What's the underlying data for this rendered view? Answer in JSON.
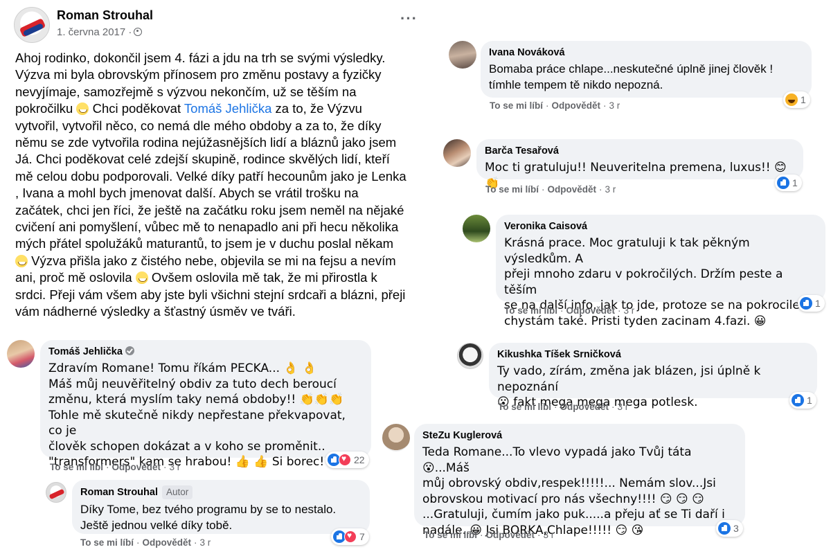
{
  "post": {
    "author": "Roman Strouhal",
    "date": "1. června 2017 ·",
    "more_label": "···",
    "text_parts": {
      "p1": "Ahoj rodinko, dokončil jsem 4. fázi a jdu na trh se svými výsledky.\nVýzva mi byla obrovským přínosem pro změnu postavy a fyzičky\nnevyjímaje, samozřejmě  s výzvou nekončím, už se těším na\npokročilku ",
      "p2": " Chci poděkovat ",
      "mention": "Tomáš Jehlička",
      "p3": " za to, že Výzvu\nvytvořil, vytvořil něco, co nemá dle mého obdoby a za to, že díky\nněmu se zde vytvořila rodina nejúžasnějších lidí a bláznů jako jsem\nJá. Chci poděkovat celé zdejší skupině, rodince skvělých lidí, kteří\nmě celou dobu podporovali. Velké díky patří hecounům jako je Lenka\n, Ivana a mohl bych jmenovat další. Abych se vrátil trošku na\nzačátek, chci jen říci, že ještě na začátku roku jsem neměl na nějaké\ncvičení ani pomyšlení, vůbec mě to nenapadlo ani při hecu několika\nmých přátel spolužáků maturantů, to jsem je v duchu poslal někam\n",
      "p4": " Výzva přišla jako z čistého nebe, objevila se mi na fejsu a nevím\nani, proč mě oslovila ",
      "p5": " Ovšem oslovila mě tak, že mi přirostla k\nsrdci. Přeji vám všem aby jste byli všichni stejní srdcaři a blázni, přeji\nvám nádherné výsledky a šťastný úsměv ve tváři."
    }
  },
  "actions": {
    "like": "To se mi líbí",
    "reply": "Odpovědět",
    "sep": "·"
  },
  "comments": {
    "tomas": {
      "author": "Tomáš Jehlička",
      "text": "Zdravím Romane! Tomu říkám PECKA... 👌 👌\nMáš můj neuvěřitelný obdiv za tuto dech beroucí\nzměnu, která myslím taky nemá obdoby!! 👏👏👏\nTohle mě skutečně nikdy nepřestane překvapovat, co je\nčlověk schopen dokázat a v koho se proměnit..\n\"transformers\" kam se hrabou! 👍 👍 Si borec!",
      "age": "3 r",
      "reactions": "22"
    },
    "roman_reply": {
      "author": "Roman Strouhal",
      "tag": "Autor",
      "text": "Díky Tome, bez tvého programu by se to nestalo.\nJeště jednou velké díky tobě.",
      "age": "3 r",
      "reactions": "7"
    },
    "ivana": {
      "author": "Ivana Nováková",
      "text": "Bomaba práce chlape...neskutečné úplně jinej člověk !\ntímhle tempem tě nikdo nepozná.",
      "age": "3 r",
      "reactions": "1"
    },
    "barca": {
      "author": "Barča Tesařová",
      "text": "Moc ti gratuluju!! Neuveritelna premena, luxus!! 😊👏",
      "age": "3 r",
      "reactions": "1"
    },
    "veronika": {
      "author": "Veronika Caisová",
      "text": "Krásná prace. Moc gratuluji k tak pěkným výsledkům. A\npřeji mnoho zdaru v pokročilých. Držím peste a těším\nse na další info, jak to jde, protoze se na pokrocile\nchystám také. Pristi tyden zacinam 4.fazi. 😀",
      "age": "3 r",
      "reactions": "1"
    },
    "kikushka": {
      "author": "Kikushka Tíšek Srnička",
      "author_full": "Kikushka Tíšek Srničková",
      "text": "Ty vado, zírám, změna jak blázen, jsi úplně k nepoznání\n😮 fakt mega mega mega potlesk.",
      "age": "3 r",
      "reactions": "1"
    },
    "stezu": {
      "author": "SteZu Kuglerová",
      "text": "Teda Romane...To vlevo vypadá jako Tvůj táta 😮...Máš\nmůj obrovský obdiv,respek!!!!!... Nemám slov...Jsi\nobrovskou motivací pro nás všechny!!!! 😏  😏  😏\n...Gratuluji, čumím jako puk.....a přeju ať se Ti daří i\nnadále..😀 Jsi BORKA,Chlape!!!!! 😏  😘",
      "age": "3 r",
      "reactions": "3"
    }
  }
}
